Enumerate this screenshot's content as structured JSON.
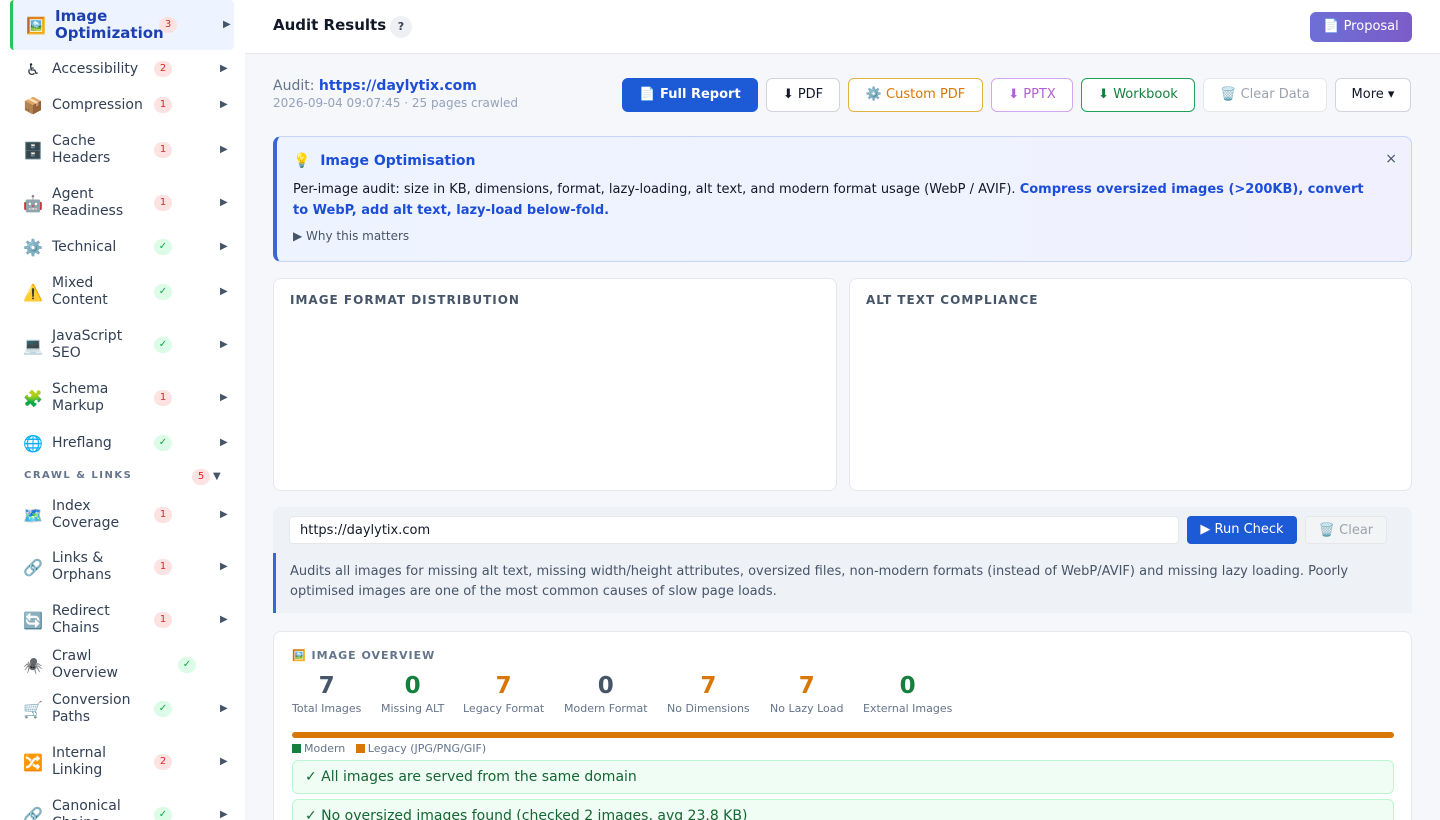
{
  "sidebar": {
    "active": {
      "icon": "🖼️",
      "label_line1": "Image",
      "label_line2": "Optimization",
      "badge": "3"
    },
    "items": [
      {
        "icon": "♿",
        "label_line1": "Accessibility",
        "label_line2": "",
        "badge": "2",
        "badge_type": "red"
      },
      {
        "icon": "📦",
        "label_line1": "Compression",
        "label_line2": "",
        "badge": "1",
        "badge_type": "red"
      },
      {
        "icon": "🗄️",
        "label_line1": "Cache",
        "label_line2": "Headers",
        "badge": "1",
        "badge_type": "red"
      },
      {
        "icon": "🤖",
        "label_line1": "Agent",
        "label_line2": "Readiness",
        "badge": "1",
        "badge_type": "red"
      },
      {
        "icon": "⚙️",
        "label_line1": "Technical",
        "label_line2": "",
        "badge": "✓",
        "badge_type": "green"
      },
      {
        "icon": "⚠️",
        "label_line1": "Mixed",
        "label_line2": "Content",
        "badge": "✓",
        "badge_type": "green"
      },
      {
        "icon": "💻",
        "label_line1": "JavaScript",
        "label_line2": "SEO",
        "badge": "✓",
        "badge_type": "green"
      },
      {
        "icon": "🧩",
        "label_line1": "Schema",
        "label_line2": "Markup",
        "badge": "1",
        "badge_type": "red"
      },
      {
        "icon": "🌐",
        "label_line1": "Hreflang",
        "label_line2": "",
        "badge": "✓",
        "badge_type": "green"
      }
    ],
    "section": {
      "label": "CRAWL & LINKS",
      "badge": "5"
    },
    "crawl_items": [
      {
        "icon": "🗺️",
        "label_line1": "Index",
        "label_line2": "Coverage",
        "badge": "1",
        "badge_type": "red"
      },
      {
        "icon": "🔗",
        "label_line1": "Links &",
        "label_line2": "Orphans",
        "badge": "1",
        "badge_type": "red"
      },
      {
        "icon": "🔄",
        "label_line1": "Redirect",
        "label_line2": "Chains",
        "badge": "1",
        "badge_type": "red"
      },
      {
        "icon": "🕷️",
        "label_line1": "Crawl Overview",
        "label_line2": "",
        "badge": "✓",
        "badge_type": "green"
      },
      {
        "icon": "🛒",
        "label_line1": "Conversion",
        "label_line2": "Paths",
        "badge": "✓",
        "badge_type": "green"
      },
      {
        "icon": "🔀",
        "label_line1": "Internal",
        "label_line2": "Linking",
        "badge": "2",
        "badge_type": "red"
      },
      {
        "icon": "🔗",
        "label_line1": "Canonical",
        "label_line2": "Chains",
        "badge": "✓",
        "badge_type": "green"
      }
    ]
  },
  "header": {
    "title": "Audit Results",
    "help": "?",
    "proposal": "📄 Proposal"
  },
  "audit": {
    "prefix": "Audit: ",
    "url": "https://daylytix.com",
    "meta": "2026-09-04 09:07:45 · 25 pages crawled"
  },
  "toolbar": {
    "full_report": "📄 Full Report",
    "pdf": "⬇ PDF",
    "custom_pdf": "⚙️ Custom PDF",
    "pptx": "⬇ PPTX",
    "workbook": "⬇ Workbook",
    "clear_data": "🗑️ Clear Data",
    "more": "More ▾"
  },
  "info": {
    "icon": "💡",
    "title": "Image Optimisation",
    "body": "Per-image audit: size in KB, dimensions, format, lazy-loading, alt text, and modern format usage (WebP / AVIF). ",
    "body_bold": "Compress oversized images (>200KB), convert to WebP, add alt text, lazy-load below-fold.",
    "why": "▶ Why this matters",
    "close": "×"
  },
  "charts": {
    "format_title": "IMAGE FORMAT DISTRIBUTION",
    "alt_title": "ALT TEXT COMPLIANCE"
  },
  "check": {
    "url_value": "https://daylytix.com",
    "run": "▶ Run Check",
    "clear": "🗑️ Clear",
    "desc": "Audits all images for missing alt text, missing width/height attributes, oversized files, non-modern formats (instead of WebP/AVIF) and missing lazy loading. Poorly optimised images are one of the most common causes of slow page loads."
  },
  "overview": {
    "title": "🖼️ IMAGE OVERVIEW",
    "stats": [
      {
        "value": "7",
        "label": "Total Images",
        "color": "#475569"
      },
      {
        "value": "0",
        "label": "Missing ALT",
        "color": "#15803d"
      },
      {
        "value": "7",
        "label": "Legacy Format",
        "color": "#d97706"
      },
      {
        "value": "0",
        "label": "Modern Format",
        "color": "#475569"
      },
      {
        "value": "7",
        "label": "No Dimensions",
        "color": "#d97706"
      },
      {
        "value": "7",
        "label": "No Lazy Load",
        "color": "#d97706"
      },
      {
        "value": "0",
        "label": "External Images",
        "color": "#15803d"
      }
    ],
    "legend_modern": "Modern",
    "legend_legacy": "Legacy (JPG/PNG/GIF)",
    "checks": [
      "✓  All images are served from the same domain",
      "✓  No oversized images found (checked 2 images, avg 23.8 KB)"
    ]
  }
}
